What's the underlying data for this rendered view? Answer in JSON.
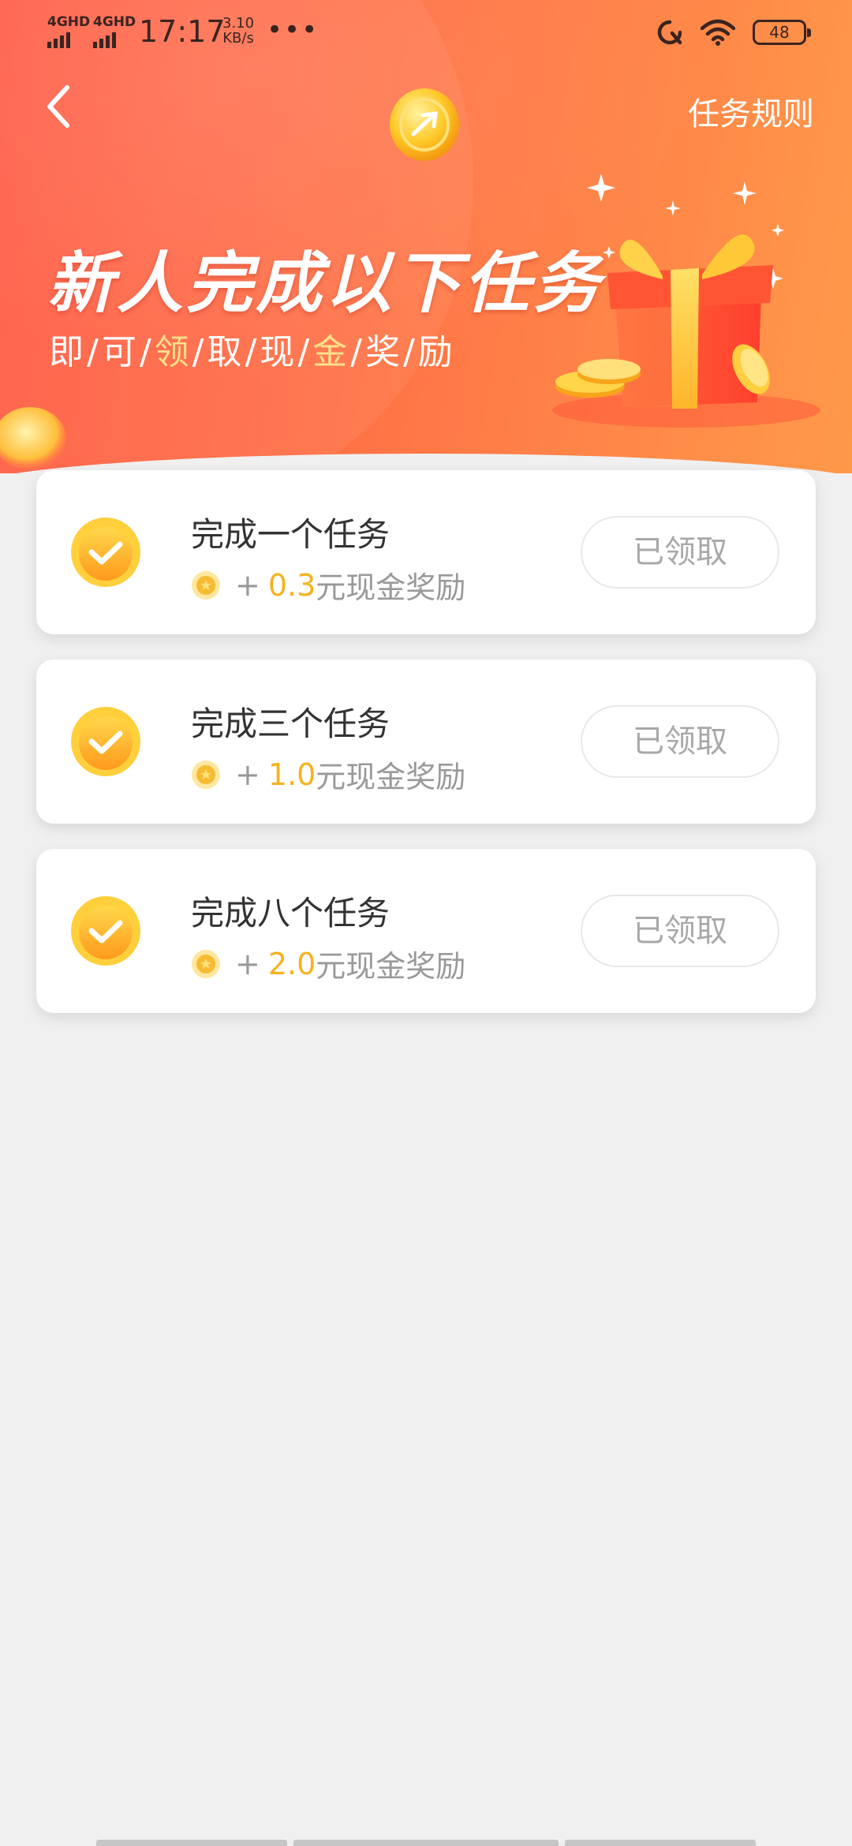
{
  "status_bar": {
    "signal1": "4GHD",
    "signal2": "4GHD",
    "time": "17:17",
    "speed_value": "3.10",
    "speed_unit": "KB/s",
    "dots": "•••",
    "battery": "48"
  },
  "header": {
    "rules_link": "任务规则",
    "headline": "新人完成以下任务",
    "subline": [
      "即",
      "可",
      "领",
      "取",
      "现",
      "金",
      "奖",
      "励"
    ],
    "subline_sep": "/"
  },
  "tasks": [
    {
      "title": "完成一个任务",
      "plus": "+",
      "amount": "0.3",
      "reward_suffix": "元现金奖励",
      "button": "已领取"
    },
    {
      "title": "完成三个任务",
      "plus": "+",
      "amount": "1.0",
      "reward_suffix": "元现金奖励",
      "button": "已领取"
    },
    {
      "title": "完成八个任务",
      "plus": "+",
      "amount": "2.0",
      "reward_suffix": "元现金奖励",
      "button": "已领取"
    }
  ],
  "colors": {
    "banner_start": "#ff5a45",
    "banner_end": "#ff9a4a",
    "amount": "#f6b21e",
    "subline_highlight": "#ffe08a",
    "page_bg": "#f0f0f0"
  },
  "icons": [
    "back-chevron-icon",
    "check-badge-icon",
    "coin-icon",
    "gift-box-icon",
    "wifi-icon",
    "refresh-icon",
    "battery-icon",
    "signal-icon"
  ]
}
